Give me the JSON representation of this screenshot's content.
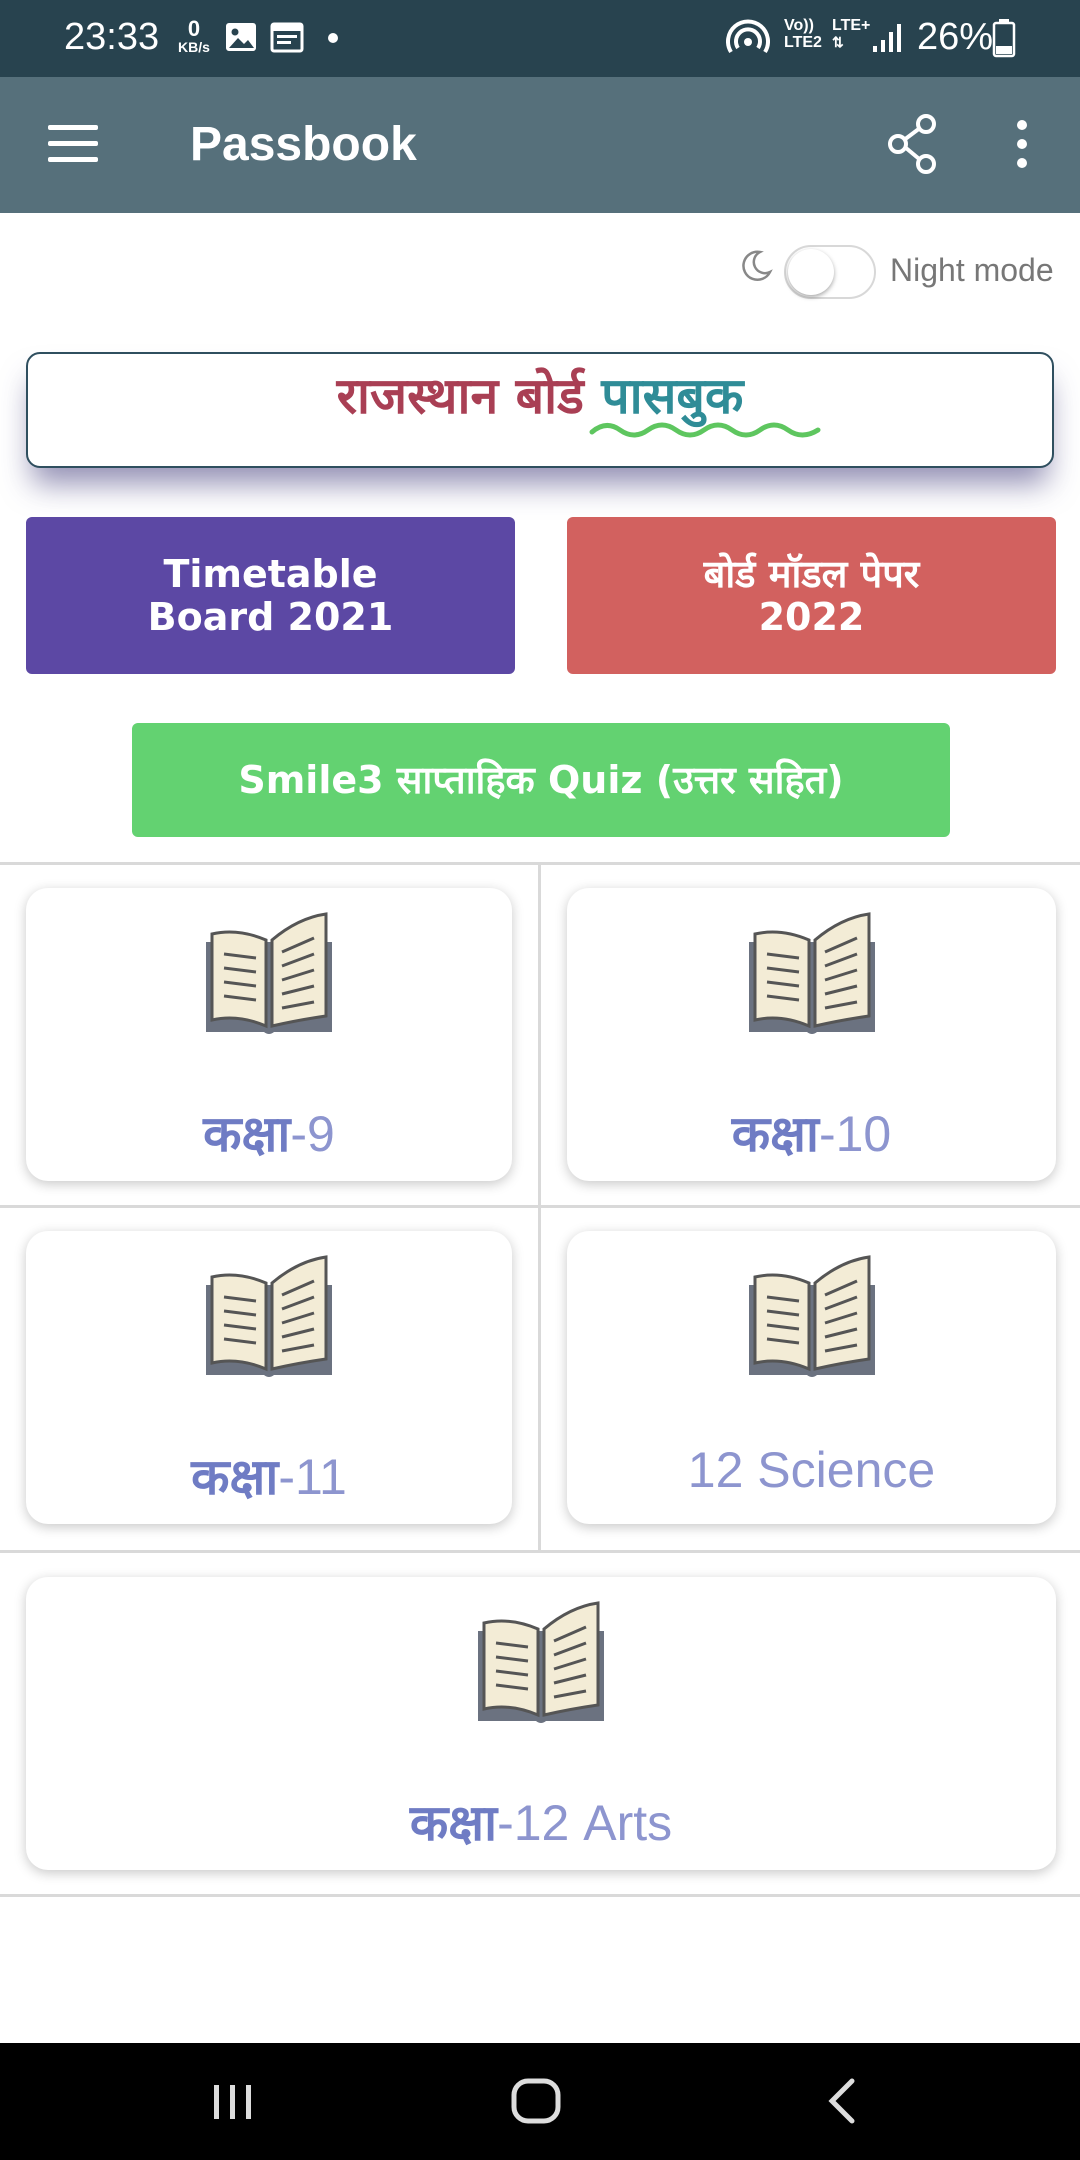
{
  "status_bar": {
    "time": "23:33",
    "net_speed_value": "0",
    "net_speed_unit": "KB/s",
    "volte_line1": "Vo))",
    "volte_line2": "LTE2",
    "lte_label": "LTE+",
    "battery_percent": "26%"
  },
  "app_bar": {
    "title": "Passbook",
    "menu_icon": "hamburger-icon",
    "share_icon": "share-icon",
    "more_icon": "more-vert-icon",
    "background_color": "#56707b"
  },
  "night_mode": {
    "label": "Night mode",
    "enabled": false,
    "icon": "moon-icon"
  },
  "banner": {
    "text_part1": "राजस्थान बोर्ड",
    "text_part2": "पासबुक"
  },
  "buttons": {
    "timetable_line1": "Timetable",
    "timetable_line2": "Board 2021",
    "timetable_color": "#5c48a4",
    "model_paper_line1": "बोर्ड मॉडल पेपर",
    "model_paper_line2": "2022",
    "model_paper_color": "#d2615f",
    "quiz_label": "Smile3 साप्ताहिक Quiz (उत्तर सहित)",
    "quiz_color": "#63d271"
  },
  "cards": [
    {
      "icon": "open-book-icon",
      "label_dev": "कक्षा",
      "label_rest": "-9"
    },
    {
      "icon": "open-book-icon",
      "label_dev": "कक्षा",
      "label_rest": "-10"
    },
    {
      "icon": "open-book-icon",
      "label_dev": "कक्षा",
      "label_rest": "-11"
    },
    {
      "icon": "open-book-icon",
      "label_dev": "",
      "label_rest": "12 Science"
    },
    {
      "icon": "open-book-icon",
      "label_dev": "कक्षा",
      "label_rest": "-12 Arts"
    }
  ],
  "nav_bar": {
    "recents_icon": "recents-icon",
    "home_icon": "home-icon",
    "back_icon": "back-icon"
  }
}
